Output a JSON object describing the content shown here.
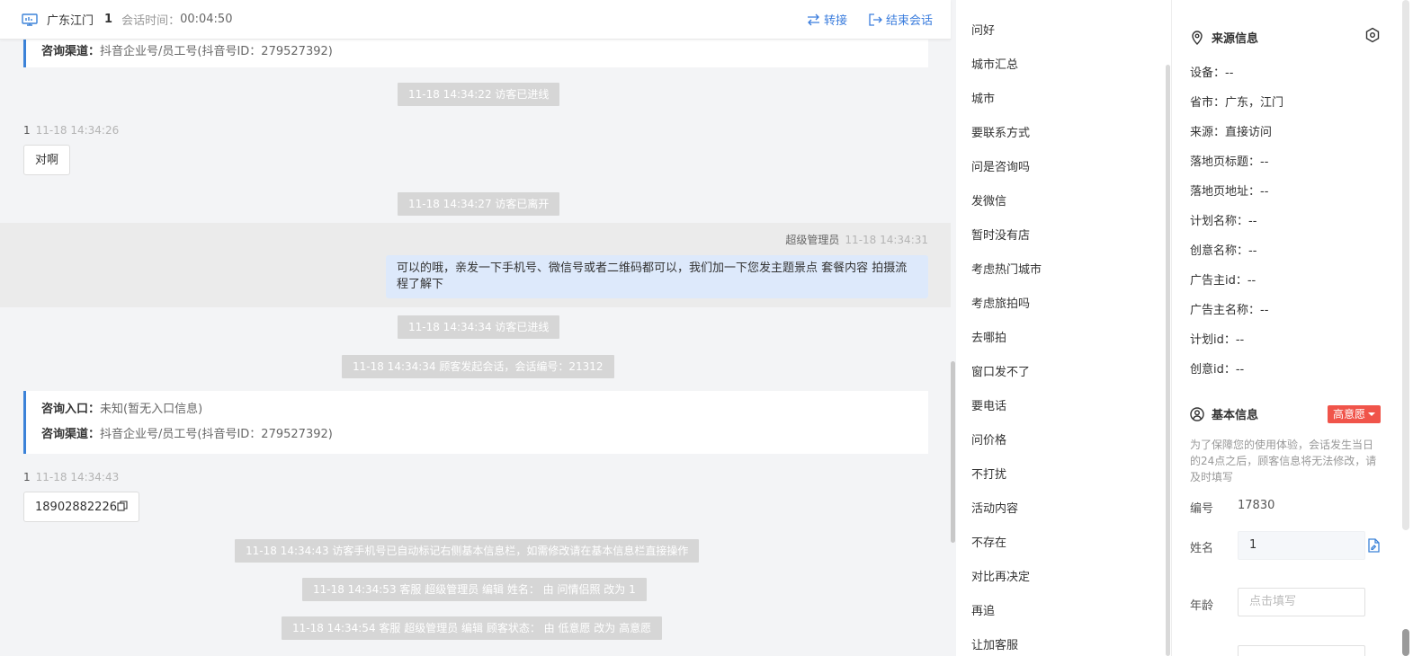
{
  "header": {
    "location": "广东江门",
    "user": "1",
    "session_time_label": "会话时间：",
    "session_time": "00:04:50",
    "transfer_label": "转接",
    "end_label": "结束会话"
  },
  "chat": {
    "top_card": {
      "channel_key": "咨询渠道：",
      "channel_val": "抖音企业号/员工号(抖音号ID：279527392)"
    },
    "sys1": "11-18 14:34:22 访客已进线",
    "msg1": {
      "sender": "1",
      "time": "11-18 14:34:26",
      "text": "对啊"
    },
    "sys2": "11-18 14:34:27 访客已离开",
    "agent": {
      "sender": "超级管理员",
      "time": "11-18 14:34:31",
      "text": "可以的哦，亲发一下手机号、微信号或者二维码都可以，我们加一下您发主题景点 套餐内容 拍摄流程了解下"
    },
    "sys3": "11-18 14:34:34 访客已进线",
    "sys4": "11-18 14:34:34 顾客发起会话，会话编号：21312",
    "card2": {
      "entry_key": "咨询入口：",
      "entry_val": "未知(暂无入口信息)",
      "channel_key": "咨询渠道：",
      "channel_val": "抖音企业号/员工号(抖音号ID：279527392)"
    },
    "msg2": {
      "sender": "1",
      "time": "11-18 14:34:43",
      "text": "18902882226"
    },
    "sys5": "11-18 14:34:43 访客手机号已自动标记右侧基本信息栏，如需修改请在基本信息栏直接操作",
    "sys6": "11-18 14:34:53 客服 超级管理员 编辑 姓名： 由 问情侣照 改为 1",
    "sys7": "11-18 14:34:54 客服 超级管理员 编辑 顾客状态： 由 低意愿 改为 高意愿"
  },
  "quick_replies": [
    "问好",
    "城市汇总",
    "城市",
    "要联系方式",
    "问是咨询吗",
    "发微信",
    "暂时没有店",
    "考虑热门城市",
    "考虑旅拍吗",
    "去哪拍",
    "窗口发不了",
    "要电话",
    "问价格",
    "不打扰",
    "活动内容",
    "不存在",
    "对比再决定",
    "再追",
    "让加客服"
  ],
  "source_info": {
    "title": "来源信息",
    "fields": [
      "设备：--",
      "省市：广东，江门",
      "来源：直接访问",
      "落地页标题：--",
      "落地页地址：--",
      "计划名称：--",
      "创意名称：--",
      "广告主id：--",
      "广告主名称：--",
      "计划id：--",
      "创意id：--"
    ]
  },
  "basic_info": {
    "title": "基本信息",
    "intent_tag": "高意愿",
    "notice": "为了保障您的使用体验，会话发生当日的24点之后，顾客信息将无法修改，请及时填写",
    "id_label": "编号",
    "id_value": "17830",
    "name_label": "姓名",
    "name_value": "1",
    "age_label": "年龄",
    "age_placeholder": "点击填写"
  },
  "colors": {
    "accent": "#3b82d8",
    "tag_red": "#f0544a",
    "system_msg": "#d6d6d6",
    "agent_bubble": "#dde9fb"
  }
}
